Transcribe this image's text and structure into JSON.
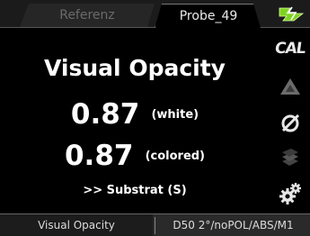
{
  "tabs": [
    {
      "label": "Referenz"
    },
    {
      "label": "Probe_49"
    }
  ],
  "measurement": {
    "title": "Visual Opacity",
    "white_value": "0.87",
    "white_label": "(white)",
    "colored_value": "0.87",
    "colored_label": "(colored)",
    "substrat_link": ">> Substrat (S)"
  },
  "side_icons": [
    {
      "name": "cal-icon",
      "text": "CAL"
    },
    {
      "name": "triangle-icon"
    },
    {
      "name": "slashed-circle-icon"
    },
    {
      "name": "stack-icon"
    },
    {
      "name": "gear-icon"
    }
  ],
  "status_bar": {
    "mode_label": "Visual Opacity",
    "settings_label": "D50 2°/noPOL/ABS/M1"
  },
  "colors": {
    "background": "#000000",
    "text": "#ffffff",
    "power_indicator": "#7dd321"
  }
}
